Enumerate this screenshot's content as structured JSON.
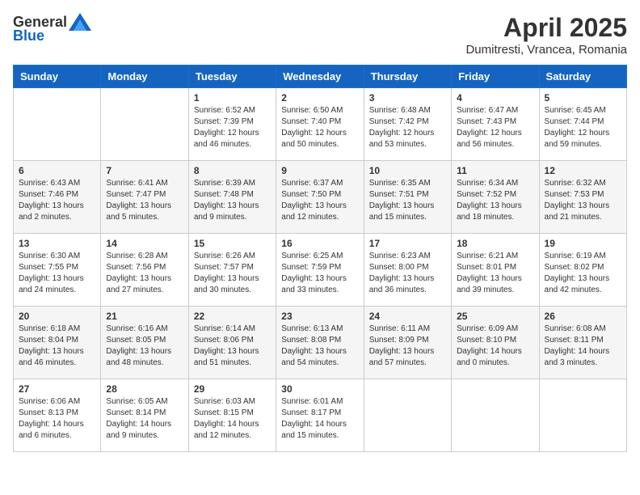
{
  "header": {
    "logo_general": "General",
    "logo_blue": "Blue",
    "month_year": "April 2025",
    "location": "Dumitresti, Vrancea, Romania"
  },
  "days_of_week": [
    "Sunday",
    "Monday",
    "Tuesday",
    "Wednesday",
    "Thursday",
    "Friday",
    "Saturday"
  ],
  "weeks": [
    [
      {
        "day": "",
        "info": ""
      },
      {
        "day": "",
        "info": ""
      },
      {
        "day": "1",
        "info": "Sunrise: 6:52 AM\nSunset: 7:39 PM\nDaylight: 12 hours and 46 minutes."
      },
      {
        "day": "2",
        "info": "Sunrise: 6:50 AM\nSunset: 7:40 PM\nDaylight: 12 hours and 50 minutes."
      },
      {
        "day": "3",
        "info": "Sunrise: 6:48 AM\nSunset: 7:42 PM\nDaylight: 12 hours and 53 minutes."
      },
      {
        "day": "4",
        "info": "Sunrise: 6:47 AM\nSunset: 7:43 PM\nDaylight: 12 hours and 56 minutes."
      },
      {
        "day": "5",
        "info": "Sunrise: 6:45 AM\nSunset: 7:44 PM\nDaylight: 12 hours and 59 minutes."
      }
    ],
    [
      {
        "day": "6",
        "info": "Sunrise: 6:43 AM\nSunset: 7:46 PM\nDaylight: 13 hours and 2 minutes."
      },
      {
        "day": "7",
        "info": "Sunrise: 6:41 AM\nSunset: 7:47 PM\nDaylight: 13 hours and 5 minutes."
      },
      {
        "day": "8",
        "info": "Sunrise: 6:39 AM\nSunset: 7:48 PM\nDaylight: 13 hours and 9 minutes."
      },
      {
        "day": "9",
        "info": "Sunrise: 6:37 AM\nSunset: 7:50 PM\nDaylight: 13 hours and 12 minutes."
      },
      {
        "day": "10",
        "info": "Sunrise: 6:35 AM\nSunset: 7:51 PM\nDaylight: 13 hours and 15 minutes."
      },
      {
        "day": "11",
        "info": "Sunrise: 6:34 AM\nSunset: 7:52 PM\nDaylight: 13 hours and 18 minutes."
      },
      {
        "day": "12",
        "info": "Sunrise: 6:32 AM\nSunset: 7:53 PM\nDaylight: 13 hours and 21 minutes."
      }
    ],
    [
      {
        "day": "13",
        "info": "Sunrise: 6:30 AM\nSunset: 7:55 PM\nDaylight: 13 hours and 24 minutes."
      },
      {
        "day": "14",
        "info": "Sunrise: 6:28 AM\nSunset: 7:56 PM\nDaylight: 13 hours and 27 minutes."
      },
      {
        "day": "15",
        "info": "Sunrise: 6:26 AM\nSunset: 7:57 PM\nDaylight: 13 hours and 30 minutes."
      },
      {
        "day": "16",
        "info": "Sunrise: 6:25 AM\nSunset: 7:59 PM\nDaylight: 13 hours and 33 minutes."
      },
      {
        "day": "17",
        "info": "Sunrise: 6:23 AM\nSunset: 8:00 PM\nDaylight: 13 hours and 36 minutes."
      },
      {
        "day": "18",
        "info": "Sunrise: 6:21 AM\nSunset: 8:01 PM\nDaylight: 13 hours and 39 minutes."
      },
      {
        "day": "19",
        "info": "Sunrise: 6:19 AM\nSunset: 8:02 PM\nDaylight: 13 hours and 42 minutes."
      }
    ],
    [
      {
        "day": "20",
        "info": "Sunrise: 6:18 AM\nSunset: 8:04 PM\nDaylight: 13 hours and 46 minutes."
      },
      {
        "day": "21",
        "info": "Sunrise: 6:16 AM\nSunset: 8:05 PM\nDaylight: 13 hours and 48 minutes."
      },
      {
        "day": "22",
        "info": "Sunrise: 6:14 AM\nSunset: 8:06 PM\nDaylight: 13 hours and 51 minutes."
      },
      {
        "day": "23",
        "info": "Sunrise: 6:13 AM\nSunset: 8:08 PM\nDaylight: 13 hours and 54 minutes."
      },
      {
        "day": "24",
        "info": "Sunrise: 6:11 AM\nSunset: 8:09 PM\nDaylight: 13 hours and 57 minutes."
      },
      {
        "day": "25",
        "info": "Sunrise: 6:09 AM\nSunset: 8:10 PM\nDaylight: 14 hours and 0 minutes."
      },
      {
        "day": "26",
        "info": "Sunrise: 6:08 AM\nSunset: 8:11 PM\nDaylight: 14 hours and 3 minutes."
      }
    ],
    [
      {
        "day": "27",
        "info": "Sunrise: 6:06 AM\nSunset: 8:13 PM\nDaylight: 14 hours and 6 minutes."
      },
      {
        "day": "28",
        "info": "Sunrise: 6:05 AM\nSunset: 8:14 PM\nDaylight: 14 hours and 9 minutes."
      },
      {
        "day": "29",
        "info": "Sunrise: 6:03 AM\nSunset: 8:15 PM\nDaylight: 14 hours and 12 minutes."
      },
      {
        "day": "30",
        "info": "Sunrise: 6:01 AM\nSunset: 8:17 PM\nDaylight: 14 hours and 15 minutes."
      },
      {
        "day": "",
        "info": ""
      },
      {
        "day": "",
        "info": ""
      },
      {
        "day": "",
        "info": ""
      }
    ]
  ]
}
